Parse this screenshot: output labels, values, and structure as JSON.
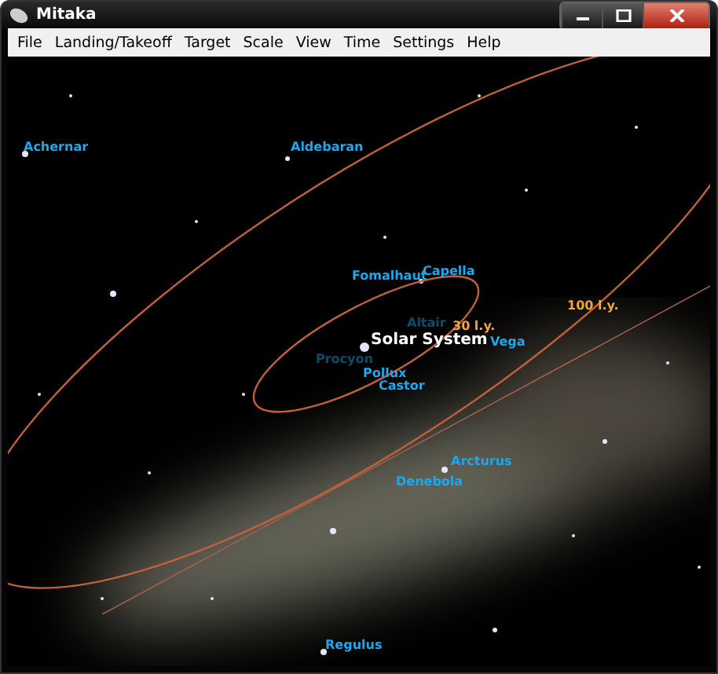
{
  "window": {
    "title": "Mitaka"
  },
  "menu": [
    "File",
    "Landing/Takeoff",
    "Target",
    "Scale",
    "View",
    "Time",
    "Settings",
    "Help"
  ],
  "labels": [
    {
      "text": "Achernar",
      "kind": "star",
      "faded": false
    },
    {
      "text": "Aldebaran",
      "kind": "star",
      "faded": false
    },
    {
      "text": "Fomalhaut",
      "kind": "star",
      "faded": false
    },
    {
      "text": "Capella",
      "kind": "star",
      "faded": false
    },
    {
      "text": "100 l.y.",
      "kind": "distance",
      "faded": false
    },
    {
      "text": "Altair",
      "kind": "star",
      "faded": true
    },
    {
      "text": "30 l.y.",
      "kind": "distance",
      "faded": false
    },
    {
      "text": "Solar System",
      "kind": "system",
      "faded": false
    },
    {
      "text": "Vega",
      "kind": "star",
      "faded": false
    },
    {
      "text": "Procyon",
      "kind": "star",
      "faded": true
    },
    {
      "text": "Pollux",
      "kind": "star",
      "faded": false
    },
    {
      "text": "Castor",
      "kind": "star",
      "faded": false
    },
    {
      "text": "Arcturus",
      "kind": "star",
      "faded": false
    },
    {
      "text": "Denebola",
      "kind": "star",
      "faded": false
    },
    {
      "text": "Regulus",
      "kind": "star",
      "faded": false
    }
  ]
}
